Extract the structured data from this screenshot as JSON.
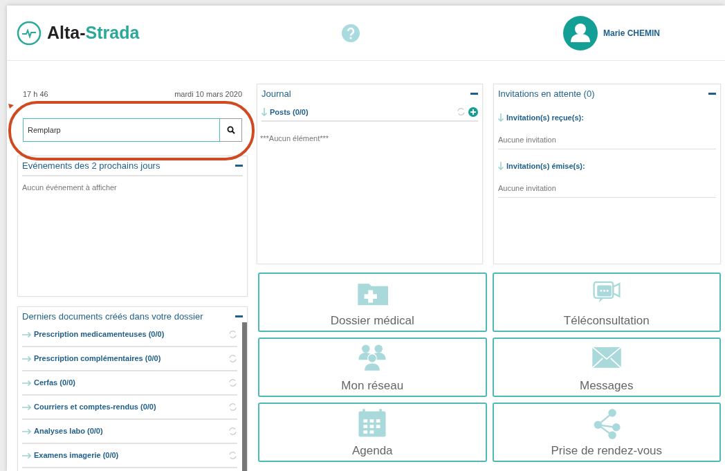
{
  "header": {
    "logo": {
      "part_1": "Alta-",
      "part_2": "Strada"
    },
    "user_name": "Marie CHEMIN"
  },
  "clock": {
    "time": "17 h 46",
    "date": "mardi 10 mars 2020"
  },
  "search": {
    "value": "Remplarp"
  },
  "events": {
    "title": "Evénements des 2 prochains jours",
    "empty": "Aucun événement à afficher"
  },
  "documents": {
    "title": "Derniers documents créés dans votre dossier",
    "items": [
      {
        "label": "Prescription medicamenteuses (0/0)"
      },
      {
        "label": "Prescription complémentaires (0/0)"
      },
      {
        "label": "Cerfas (0/0)"
      },
      {
        "label": "Courriers et comptes-rendus (0/0)"
      },
      {
        "label": "Analyses labo (0/0)"
      },
      {
        "label": "Examens imagerie (0/0)"
      }
    ]
  },
  "journal": {
    "title": "Journal",
    "section": "Posts (0/0)",
    "empty": "***Aucun élément***"
  },
  "invitations": {
    "title": "Invitations en attente (0)",
    "sections": [
      {
        "label": "Invitation(s) reçue(s):",
        "empty": "Aucune invitation"
      },
      {
        "label": "Invitation(s) émise(s):",
        "empty": "Aucune invitation"
      }
    ]
  },
  "tiles": [
    {
      "kind": "folder",
      "label": "Dossier médical"
    },
    {
      "kind": "video",
      "label": "Téléconsultation"
    },
    {
      "kind": "people",
      "label": "Mon réseau"
    },
    {
      "kind": "mail",
      "label": "Messages"
    },
    {
      "kind": "calendar",
      "label": "Agenda"
    },
    {
      "kind": "share",
      "label": "Prise de rendez-vous"
    }
  ]
}
